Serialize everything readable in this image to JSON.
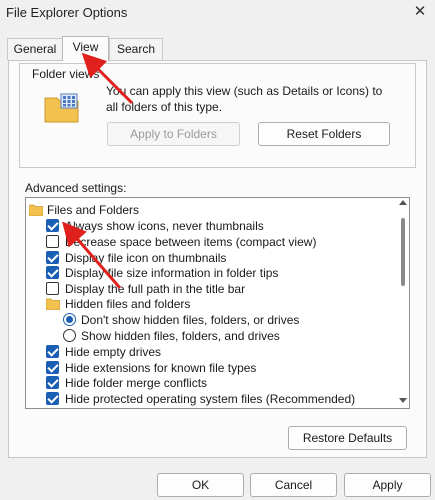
{
  "window": {
    "title": "File Explorer Options",
    "close_glyph": "✕"
  },
  "tabs": [
    {
      "label": "General",
      "active": false
    },
    {
      "label": "View",
      "active": true
    },
    {
      "label": "Search",
      "active": false
    }
  ],
  "folder_views": {
    "label": "Folder views",
    "description": "You can apply this view (such as Details or Icons) to all folders of this type.",
    "apply_button": "Apply to Folders",
    "reset_button": "Reset Folders"
  },
  "advanced": {
    "label": "Advanced settings:",
    "items": [
      {
        "type": "folder",
        "label": "Files and Folders"
      },
      {
        "type": "checkbox",
        "label": "Always show icons, never thumbnails",
        "checked": true
      },
      {
        "type": "checkbox",
        "label": "Decrease space between items (compact view)",
        "checked": false
      },
      {
        "type": "checkbox",
        "label": "Display file icon on thumbnails",
        "checked": true
      },
      {
        "type": "checkbox",
        "label": "Display file size information in folder tips",
        "checked": true
      },
      {
        "type": "checkbox",
        "label": "Display the full path in the title bar",
        "checked": false
      },
      {
        "type": "folder",
        "label": "Hidden files and folders"
      },
      {
        "type": "radio",
        "label": "Don't show hidden files, folders, or drives",
        "checked": true
      },
      {
        "type": "radio",
        "label": "Show hidden files, folders, and drives",
        "checked": false
      },
      {
        "type": "checkbox",
        "label": "Hide empty drives",
        "checked": true
      },
      {
        "type": "checkbox",
        "label": "Hide extensions for known file types",
        "checked": true
      },
      {
        "type": "checkbox",
        "label": "Hide folder merge conflicts",
        "checked": true
      },
      {
        "type": "checkbox",
        "label": "Hide protected operating system files (Recommended)",
        "checked": true
      }
    ],
    "restore_button": "Restore Defaults"
  },
  "footer": {
    "ok": "OK",
    "cancel": "Cancel",
    "apply": "Apply"
  },
  "colors": {
    "accent": "#1a5fb4",
    "annotation": "#e0201c",
    "folder": "#f2c14e"
  }
}
